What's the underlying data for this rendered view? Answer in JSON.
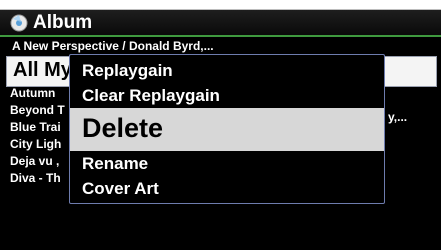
{
  "header": {
    "title": "Album",
    "icon": "album-icon",
    "accent_color": "#3f9a3f"
  },
  "subheader": "A New Perspective / Donald Byrd,...",
  "list": {
    "selected": "All My",
    "rows": [
      "Autumn",
      "Beyond T",
      "Blue Trai",
      "City Ligh",
      "Deja vu ,",
      "Diva - Th"
    ],
    "row_suffix": "y,..."
  },
  "menu": {
    "items": [
      "Replaygain",
      "Clear Replaygain",
      "Delete",
      "Rename",
      "Cover Art"
    ],
    "highlighted": "Delete"
  }
}
